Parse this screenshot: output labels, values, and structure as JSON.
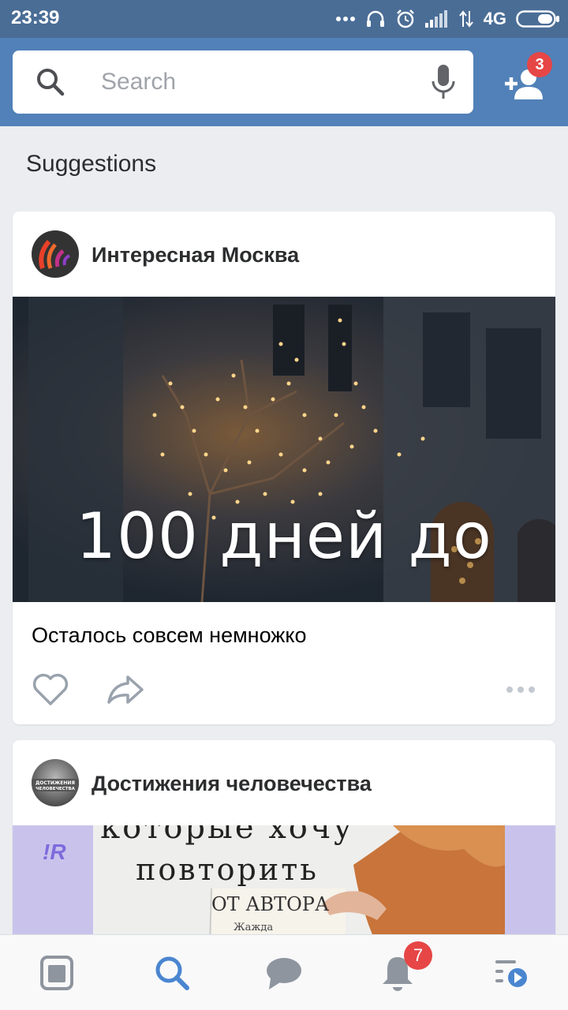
{
  "status_bar": {
    "time": "23:39",
    "network": "4G",
    "icons": [
      "more-dots-icon",
      "headphones-icon",
      "alarm-icon",
      "signal-icon",
      "data-arrows-icon",
      "battery-icon"
    ]
  },
  "header": {
    "search": {
      "placeholder": "Search",
      "value": ""
    },
    "friend_requests_count": "3",
    "accent_color": "#5181b8"
  },
  "section_title": "Suggestions",
  "posts": [
    {
      "source": "Интересная Москва",
      "image_caption": "100 дней до",
      "text": "Осталось совсем немножко"
    },
    {
      "source": "Достижения человечества",
      "avatar_text": "ДОСТИЖЕНИЯ ЧЕЛОВЕЧЕСТВА",
      "image_text": {
        "line1": "которые хочу",
        "line2": "повторить",
        "line3": "ОТ АВТОРА",
        "line4": "Жажда",
        "side_mark": "!R"
      }
    }
  ],
  "bottom_nav": {
    "items": [
      "feed-icon",
      "search-icon",
      "messages-icon",
      "notifications-icon",
      "menu-icon"
    ],
    "active": "search",
    "notifications_count": "7"
  }
}
